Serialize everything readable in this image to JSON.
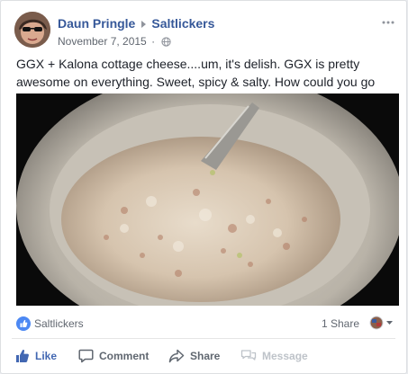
{
  "post": {
    "author": "Daun Pringle",
    "group": "Saltlickers",
    "date": "November 7, 2015",
    "dot": "·",
    "text": "GGX + Kalona cottage cheese....um, it's delish. GGX is pretty awesome on everything. Sweet, spicy & salty. How could you go wrong?",
    "photo_description_icon": "photo-cottage-cheese-bowl"
  },
  "summary": {
    "liked_by": "Saltlickers",
    "shares": "1 Share"
  },
  "actions": {
    "like": "Like",
    "comment": "Comment",
    "share": "Share",
    "message": "Message"
  },
  "colors": {
    "link": "#365899",
    "like_active": "#4267b2",
    "muted": "#616770"
  },
  "icons": {
    "more": "more-dots-icon",
    "privacy": "globe-icon",
    "like_bubble": "thumbs-up-icon"
  }
}
